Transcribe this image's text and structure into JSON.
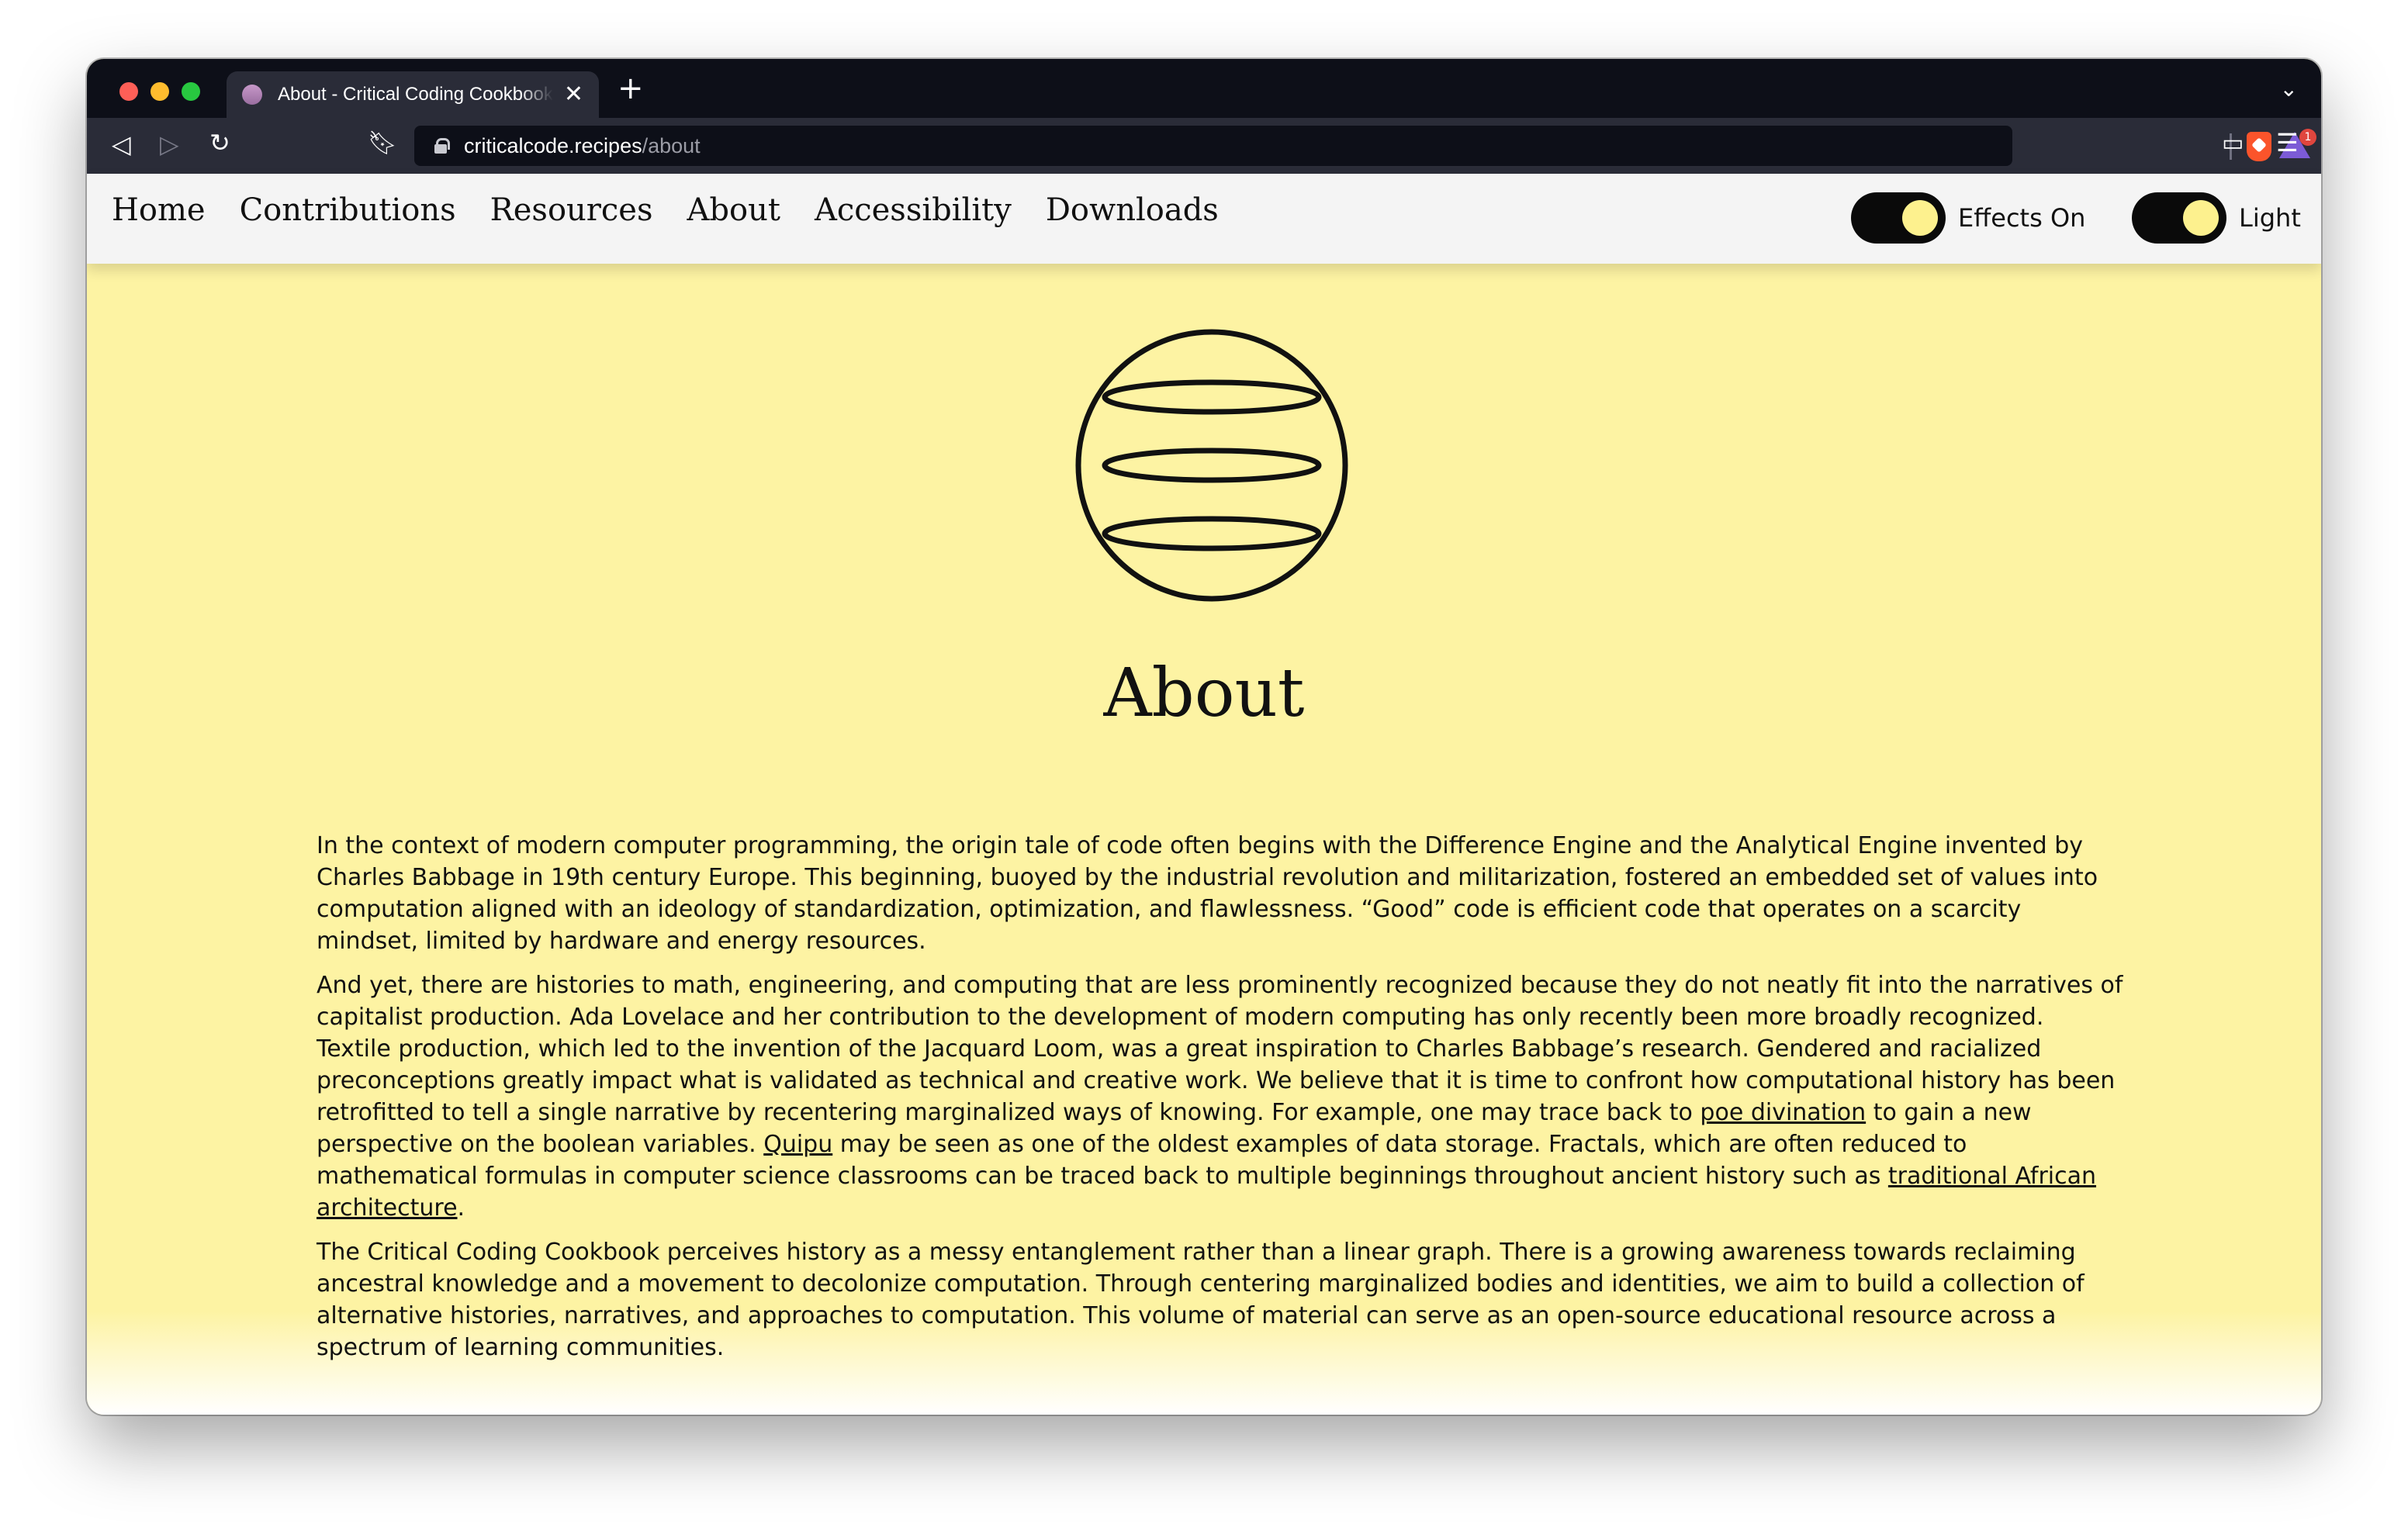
{
  "browser": {
    "tab_title": "About - Critical Coding Cookbook",
    "new_tab_icon": "plus-icon",
    "url_host": "criticalcode.recipes",
    "url_path": "/about",
    "rewards_badge": "1"
  },
  "nav": {
    "links": [
      "Home",
      "Contributions",
      "Resources",
      "About",
      "Accessibility",
      "Downloads"
    ],
    "effects_label": "Effects On",
    "theme_label": "Light"
  },
  "page": {
    "title": "About",
    "logo_icon": "striped-sphere-icon",
    "p1": "In the context of modern computer programming, the origin tale of code often begins with the Difference Engine and the Analytical Engine invented by Charles Babbage in 19th century Europe. This beginning, buoyed by the industrial revolution and militarization, fostered an embedded set of values into computation aligned with an ideology of standardization, optimization, and flawlessness. “Good” code is efficient code that operates on a scarcity mindset, limited by hardware and energy resources.",
    "p2": {
      "part1": "And yet, there are histories to math, engineering, and computing that are less prominently recognized because they do not neatly fit into the narratives of capitalist production. Ada Lovelace and her contribution to the development of modern computing has only recently been more broadly recognized. Textile production, which led to the invention of the Jacquard Loom, was a great inspiration to Charles Babbage’s research. Gendered and racialized preconceptions greatly impact what is validated as technical and creative work. We believe that it is time to confront how computational history has been retrofitted to tell a single narrative by recentering marginalized ways of knowing. For example, one may trace back to",
      "link1": "poe divination",
      "part2": "to gain a new perspective on the boolean variables.",
      "link2": "Quipu",
      "part3": "may be seen as one of the oldest examples of data storage. Fractals, which are often reduced to mathematical formulas in computer science classrooms can be traced back to multiple beginnings throughout ancient history such as",
      "link3": "traditional African architecture",
      "part4": "."
    },
    "p3": "The Critical Coding Cookbook perceives history as a messy entanglement rather than a linear graph. There is a growing awareness towards reclaiming ancestral knowledge and a movement to decolonize computation. Through centering marginalized bodies and identities, we aim to build a collection of alternative histories, narratives, and approaches to computation. This volume of material can serve as an open-source educational resource across a spectrum of learning communities."
  },
  "colors": {
    "page_bg": "#fdf3a3",
    "nav_bg": "#f4f4f4",
    "toggle_bg": "#0a0a0a",
    "toggle_knob": "#fdf18e",
    "browser_dark": "#0d0f18",
    "browser_toolbar": "#2a2c38"
  }
}
